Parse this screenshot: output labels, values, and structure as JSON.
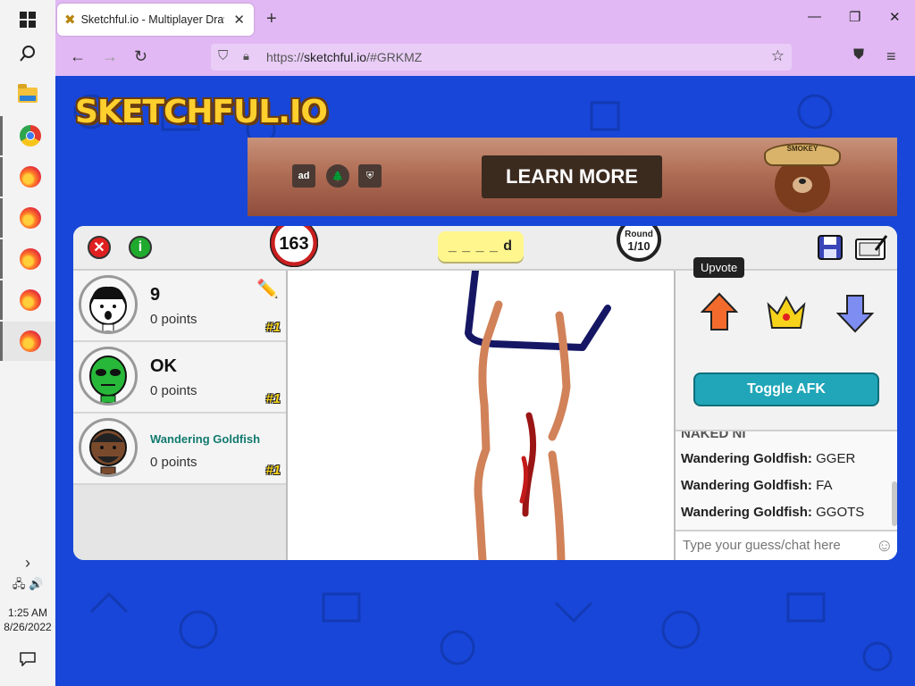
{
  "taskbar": {
    "time": "1:25 AM",
    "date": "8/26/2022",
    "chevron": "›"
  },
  "browser": {
    "tab_title": "Sketchful.io - Multiplayer Drawi",
    "url_prefix": "https://",
    "url_host": "sketchful.io",
    "url_rest": "/#GRKMZ"
  },
  "page": {
    "logo_text": "SKETCHFUL.IO",
    "ad": {
      "button_label": "LEARN MORE",
      "logo_ad": "ad",
      "hat_text": "SMOKEY"
    }
  },
  "game": {
    "timer": "163",
    "word_hint": "_ _ _ _ d",
    "round_label": "Round",
    "round_value": "1/10",
    "players": [
      {
        "name": "9",
        "points": "0 points",
        "rank": "#1"
      },
      {
        "name": "OK",
        "points": "0 points",
        "rank": "#1"
      },
      {
        "name": "Wandering Goldfish",
        "points": "0 points",
        "rank": "#1"
      }
    ],
    "tooltip": "Upvote",
    "afk_button": "Toggle AFK",
    "chat": [
      {
        "author": "NAKED NI",
        "text": ""
      },
      {
        "author": "Wandering Goldfish:",
        "text": "GGER"
      },
      {
        "author": "Wandering Goldfish:",
        "text": "FA"
      },
      {
        "author": "Wandering Goldfish:",
        "text": "GGOTS"
      }
    ],
    "chat_placeholder": "Type your guess/chat here"
  },
  "colors": {
    "page_bg": "#1746d8",
    "browser_bg": "#e1b8f3",
    "afk_button": "#20a6b8",
    "word_hint_bg": "#fff78e"
  }
}
